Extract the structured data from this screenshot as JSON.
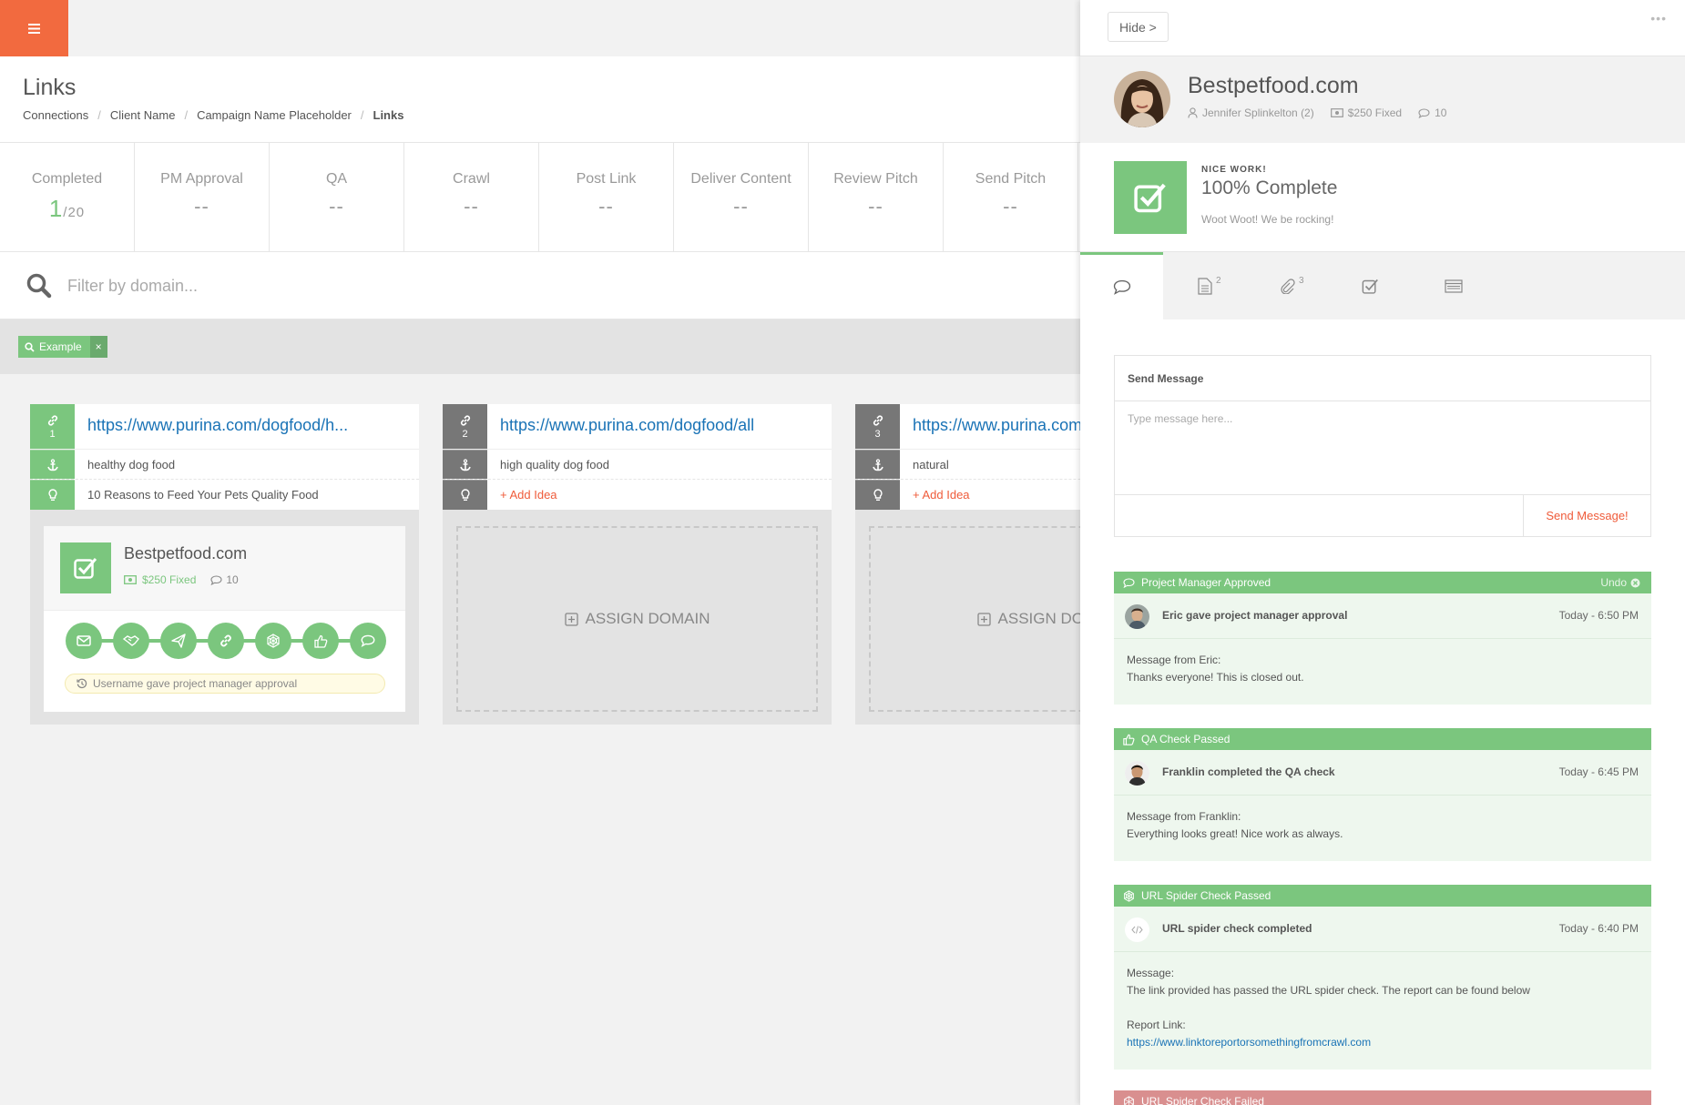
{
  "header": {
    "menu_icon": "hamburger-icon",
    "accent": "#f26a3f"
  },
  "page": {
    "title": "Links",
    "breadcrumb": [
      "Connections",
      "Client Name",
      "Campaign Name Placeholder",
      "Links"
    ]
  },
  "stats": [
    {
      "label": "Completed",
      "value": "1",
      "total": "/20"
    },
    {
      "label": "PM Approval",
      "value": "--"
    },
    {
      "label": "QA",
      "value": "--"
    },
    {
      "label": "Crawl",
      "value": "--"
    },
    {
      "label": "Post Link",
      "value": "--"
    },
    {
      "label": "Deliver Content",
      "value": "--"
    },
    {
      "label": "Review Pitch",
      "value": "--"
    },
    {
      "label": "Send Pitch",
      "value": "--"
    }
  ],
  "filter": {
    "placeholder": "Filter by domain...",
    "tag": "Example",
    "tag_close": "×"
  },
  "cards": [
    {
      "number": "1",
      "url": "https://www.purina.com/dogfood/h...",
      "anchor": "healthy dog food",
      "idea": "10 Reasons to Feed Your Pets Quality Food",
      "domain": {
        "name": "Bestpetfood.com",
        "price": "$250 Fixed",
        "comments": "10",
        "activity": "Username gave project manager approval"
      }
    },
    {
      "number": "2",
      "url": "https://www.purina.com/dogfood/all",
      "anchor": "high quality dog food",
      "idea": "+ Add Idea",
      "assign": "ASSIGN DOMAIN"
    },
    {
      "number": "3",
      "url": "https://www.purina.com/dogfood/natural",
      "anchor": "natural",
      "idea": "+ Add Idea",
      "assign": "ASSIGN DOMAIN"
    }
  ],
  "panel": {
    "hide": "Hide >",
    "more": "•••",
    "name": "Bestpetfood.com",
    "owner": "Jennifer Splinkelton (2)",
    "price": "$250 Fixed",
    "comments": "10",
    "status": {
      "kicker": "NICE WORK!",
      "percent": "100% Complete",
      "note": "Woot Woot! We be rocking!"
    },
    "tabs": [
      {
        "icon": "comment-icon",
        "count": ""
      },
      {
        "icon": "document-icon",
        "count": "2"
      },
      {
        "icon": "paperclip-icon",
        "count": "3"
      },
      {
        "icon": "checkbox-icon",
        "count": ""
      },
      {
        "icon": "list-icon",
        "count": ""
      }
    ],
    "message": {
      "title": "Send Message",
      "placeholder": "Type message here...",
      "send": "Send Message!"
    },
    "feed": [
      {
        "title": "Project Manager Approved",
        "undo": "Undo",
        "who": "Eric gave project manager approval",
        "time": "Today - 6:50 PM",
        "label": "Message from Eric:",
        "text": "Thanks everyone! This is closed out."
      },
      {
        "title": "QA Check Passed",
        "who": "Franklin completed the QA check",
        "time": "Today - 6:45 PM",
        "label": "Message from Franklin:",
        "text": "Everything looks great! Nice work as always."
      },
      {
        "title": "URL Spider Check Passed",
        "who": "URL spider check completed",
        "time": "Today - 6:40 PM",
        "label": "Message:",
        "text": "The link provided has passed the URL spider check. The report can be found below",
        "link_label": "Report Link:",
        "link": "https://www.linktoreportorsomethingfromcrawl.com"
      },
      {
        "title": "URL Spider Check Failed"
      }
    ]
  },
  "colors": {
    "green": "#7bc67e",
    "link": "#1a73b6",
    "red": "#ef5b3a"
  }
}
